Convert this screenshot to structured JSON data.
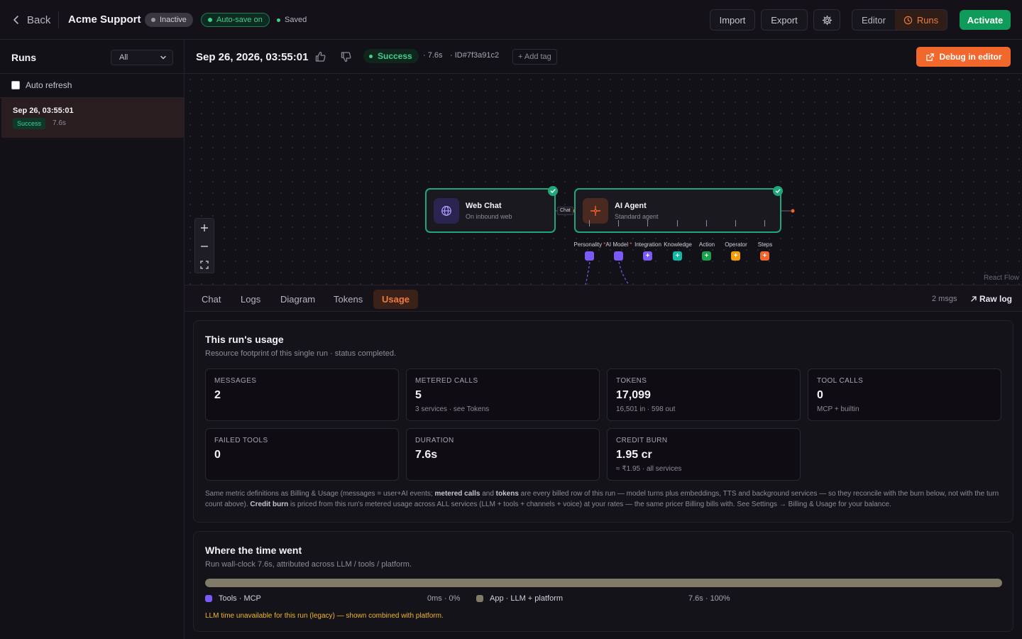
{
  "topbar": {
    "back_label": "Back",
    "app_title": "Acme Support",
    "status_badge": "Inactive",
    "autosave_badge": "Auto-save on",
    "saved_label": "Saved",
    "import_label": "Import",
    "export_label": "Export",
    "view_tabs": [
      {
        "label": "Editor",
        "active": false
      },
      {
        "label": "Runs",
        "active": true
      }
    ],
    "activate_label": "Activate",
    "accent_color": "#f07a3c",
    "success_color": "#3fd18f"
  },
  "sidebar": {
    "title": "Runs",
    "filter_value": "All",
    "auto_refresh_label": "Auto refresh",
    "auto_refresh_checked": false,
    "runs": [
      {
        "timestamp": "Sep 26, 03:55:01",
        "status": "Success",
        "duration": "7.6s"
      }
    ]
  },
  "run": {
    "timestamp": "Sep 26, 2026, 03:55:01",
    "status": "Success",
    "duration": "· 7.6s",
    "run_id": "· ID#7f3a91c2",
    "add_tag_label": "+ Add tag",
    "debug_label": "Debug in editor"
  },
  "canvas": {
    "nodes": [
      {
        "title": "Web Chat",
        "subtitle": "On inbound web",
        "icon": "globe-icon"
      },
      {
        "title": "AI Agent",
        "subtitle": "Standard agent",
        "icon": "sparkle-icon"
      }
    ],
    "edge_label": "Chat",
    "handles": [
      {
        "label": "Personality",
        "required": true,
        "color": "#7a5af8",
        "connected": true
      },
      {
        "label": "AI Model",
        "required": true,
        "color": "#7a5af8",
        "connected": true
      },
      {
        "label": "Integration",
        "required": false,
        "color": "#7a5af8",
        "connected": false
      },
      {
        "label": "Knowledge",
        "required": false,
        "color": "#14b8a6",
        "connected": false
      },
      {
        "label": "Action",
        "required": false,
        "color": "#16a34a",
        "connected": false
      },
      {
        "label": "Operator",
        "required": false,
        "color": "#f59e0b",
        "connected": false
      },
      {
        "label": "Steps",
        "required": false,
        "color": "#f2672c",
        "connected": false
      }
    ],
    "attribution": "React Flow"
  },
  "tabs": [
    {
      "label": "Chat",
      "active": false
    },
    {
      "label": "Logs",
      "active": false
    },
    {
      "label": "Diagram",
      "active": false
    },
    {
      "label": "Tokens",
      "active": false
    },
    {
      "label": "Usage",
      "active": true
    }
  ],
  "tab_meta": {
    "msgs": "2 msgs",
    "raw_log": "Raw log"
  },
  "usage": {
    "title": "This run's usage",
    "subtitle": "Resource footprint of this single run · status completed.",
    "metrics": [
      {
        "label": "MESSAGES",
        "value": "2",
        "sub": ""
      },
      {
        "label": "METERED CALLS",
        "value": "5",
        "sub": "3 services · see Tokens"
      },
      {
        "label": "TOKENS",
        "value": "17,099",
        "sub": "16,501 in · 598 out"
      },
      {
        "label": "TOOL CALLS",
        "value": "0",
        "sub": "MCP + builtin"
      },
      {
        "label": "FAILED TOOLS",
        "value": "0",
        "sub": ""
      },
      {
        "label": "DURATION",
        "value": "7.6s",
        "sub": ""
      },
      {
        "label": "CREDIT BURN",
        "value": "1.95 cr",
        "sub": "≈ ₹1.95 · all services"
      }
    ],
    "note": {
      "t1": "Same metric definitions as Billing & Usage (messages = user+AI events; ",
      "b1": "metered calls",
      "t2": " and ",
      "b2": "tokens",
      "t3": " are every billed row of this run — model turns plus embeddings, TTS and background services — so they reconcile with the burn below, not with the turn count above). ",
      "b3": "Credit burn",
      "t4": " is priced from this run's metered usage across ALL services (LLM + tools + channels + voice) at your rates — the same pricer Billing bills with. See Settings → Billing & Usage for your balance."
    }
  },
  "time": {
    "title": "Where the time went",
    "subtitle": "Run wall-clock 7.6s, attributed across LLM / tools / platform.",
    "app_fraction": 1.0,
    "segments": [
      {
        "label": "Tools · MCP",
        "value": "0ms · 0%",
        "color": "#7a5af8"
      },
      {
        "label": "App · LLM + platform",
        "value": "7.6s · 100%",
        "color": "#807a66"
      }
    ],
    "warning": "LLM time unavailable for this run (legacy) — shown combined with platform."
  }
}
